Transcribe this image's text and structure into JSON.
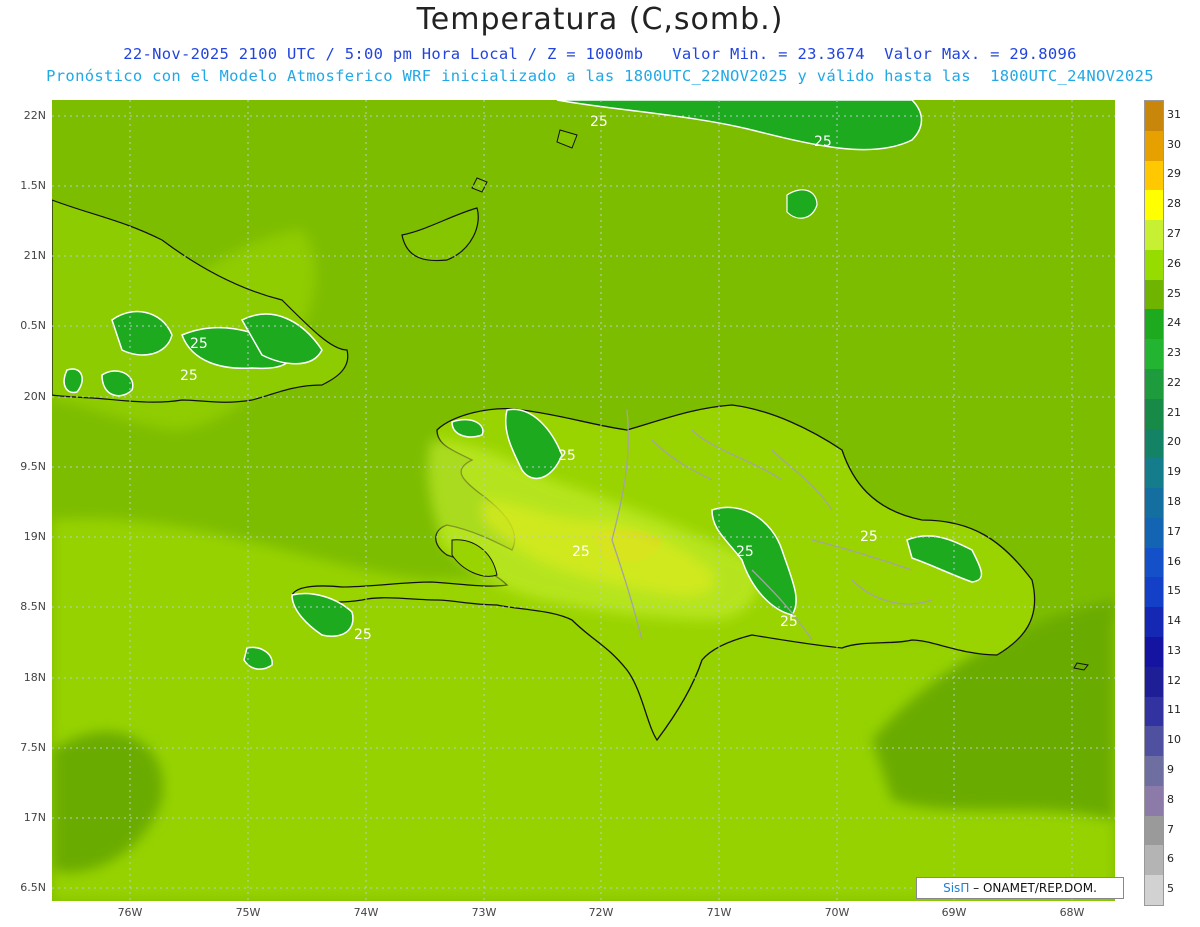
{
  "header": {
    "title": "Temperatura (C,somb.)",
    "line1": "22-Nov-2025 2100 UTC / 5:00 pm Hora Local / Z = 1000mb   Valor Min. = 23.3674  Valor Max. = 29.8096",
    "line2": "Pronóstico con el Modelo Atmosferico WRF inicializado a las 1800UTC_22NOV2025 y válido hasta las  1800UTC_24NOV2025"
  },
  "axes": {
    "lat_labels": [
      "22N",
      "1.5N",
      "21N",
      "0.5N",
      "20N",
      "9.5N",
      "19N",
      "8.5N",
      "18N",
      "7.5N",
      "17N",
      "6.5N"
    ],
    "lon_labels": [
      "76W",
      "75W",
      "74W",
      "73W",
      "72W",
      "71W",
      "70W",
      "69W",
      "68W"
    ]
  },
  "legend": {
    "values": [
      "31",
      "30",
      "29",
      "28",
      "27",
      "26",
      "25",
      "24",
      "23",
      "22",
      "21",
      "20",
      "19",
      "18",
      "17",
      "16",
      "15",
      "14",
      "13",
      "12",
      "11",
      "10",
      "9",
      "8",
      "7",
      "6",
      "5"
    ],
    "colors": [
      "#c8860a",
      "#e6a000",
      "#ffc800",
      "#ffff00",
      "#c8f032",
      "#96dc00",
      "#6eb400",
      "#1eaa1e",
      "#23b432",
      "#1e9b3c",
      "#168a46",
      "#148264",
      "#147c8a",
      "#146ea0",
      "#1464b4",
      "#1450c8",
      "#1440c8",
      "#1428b4",
      "#1414a0",
      "#1e1e96",
      "#3232a0",
      "#5050a0",
      "#6e6ea0",
      "#8c7aa8",
      "#9a9a9a",
      "#b4b4b4",
      "#d2d2d2"
    ]
  },
  "contour_labels": [
    "25",
    "25",
    "25",
    "25",
    "25",
    "25",
    "25",
    "25",
    "25",
    "25"
  ],
  "credit": {
    "brand": "SisΠ",
    "text": "– ONAMET/REP.DOM."
  }
}
